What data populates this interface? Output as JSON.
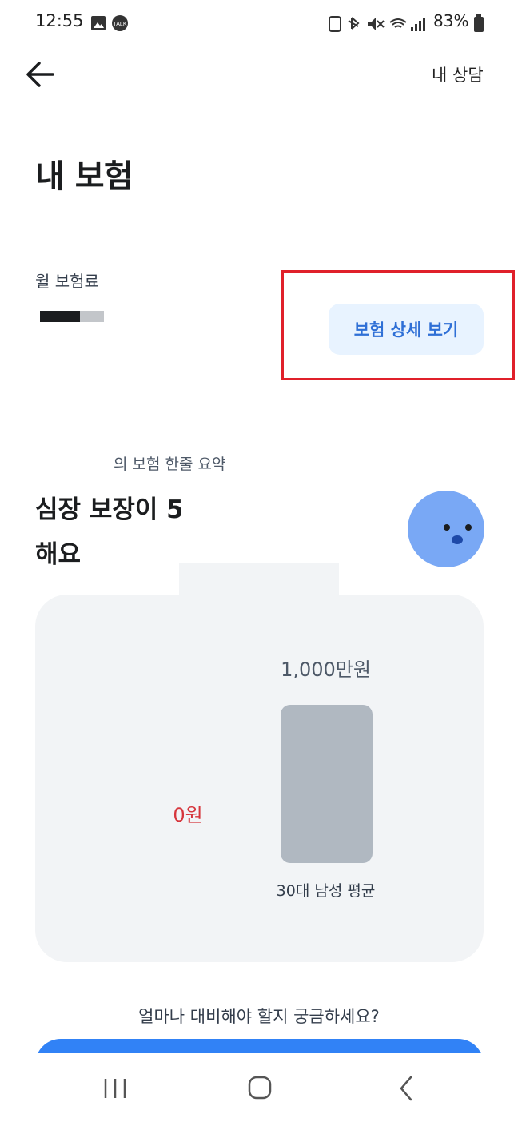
{
  "status_bar": {
    "time": "12:55",
    "battery": "83%",
    "icons": [
      "gallery-icon",
      "kakaotalk-icon",
      "battery-saver-icon",
      "bluetooth-icon",
      "mute-icon",
      "wifi-icon",
      "signal-icon",
      "battery-icon"
    ]
  },
  "header": {
    "back_icon": "arrow-left-icon",
    "consult_label": "내 상담"
  },
  "page": {
    "title": "내 보험"
  },
  "premium": {
    "label": "월 보험료",
    "detail_button": "보험 상세 보기"
  },
  "summary": {
    "label": "의 보험 한줄 요약",
    "headline_line1": "심장 보장이 5",
    "headline_line2": "해요",
    "character_icon": "worried-face-icon"
  },
  "comparison": {
    "mine_value": "0원",
    "avg_value": "1,000만원",
    "avg_label": "30대 남성 평균"
  },
  "footer": {
    "question": "얼마나 대비해야 할지 궁금하세요?"
  },
  "nav_bar": {
    "icons": [
      "recent-apps-icon",
      "home-icon",
      "back-icon"
    ]
  },
  "colors": {
    "accent": "#3182f6",
    "highlight_box": "#e0202a",
    "negative_value": "#d6363d",
    "panel_bg": "#f2f4f6"
  }
}
